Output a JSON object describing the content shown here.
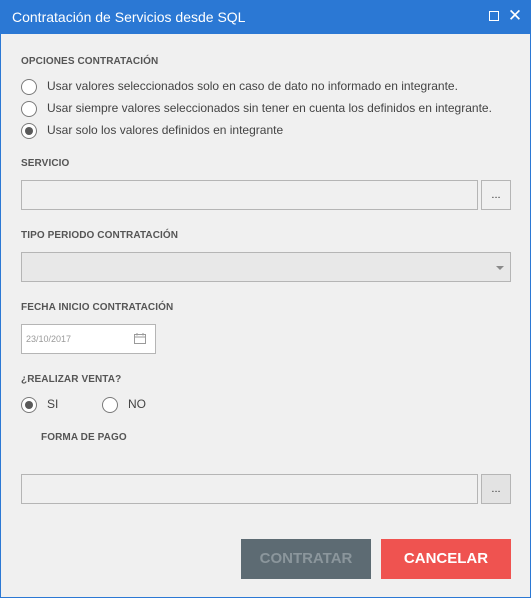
{
  "window": {
    "title": "Contratación de Servicios desde SQL",
    "close_glyph": "✕"
  },
  "opciones": {
    "label": "OPCIONES CONTRATACIÓN",
    "options": [
      {
        "label": "Usar valores seleccionados solo en caso de dato no informado en integrante.",
        "checked": false
      },
      {
        "label": "Usar siempre valores seleccionados sin tener en cuenta los definidos en integrante.",
        "checked": false
      },
      {
        "label": "Usar solo los valores definidos en integrante",
        "checked": true
      }
    ]
  },
  "servicio": {
    "label": "SERVICIO",
    "value": "",
    "button_label": "..."
  },
  "tipo_periodo": {
    "label": "TIPO PERIODO CONTRATACIÓN",
    "selected": ""
  },
  "fecha_inicio": {
    "label": "FECHA INICIO CONTRATACIÓN",
    "value": "23/10/2017"
  },
  "realizar_venta": {
    "label": "¿REALIZAR VENTA?",
    "options": [
      {
        "label": "SI",
        "checked": true
      },
      {
        "label": "NO",
        "checked": false
      }
    ]
  },
  "forma_pago": {
    "label": "FORMA DE PAGO",
    "value": "",
    "button_label": "..."
  },
  "actions": {
    "contratar_label": "CONTRATAR",
    "cancelar_label": "CANCELAR"
  },
  "colors": {
    "titlebar": "#2b78d4",
    "contratar_bg": "#5d6b73",
    "cancelar_bg": "#ef5350"
  }
}
